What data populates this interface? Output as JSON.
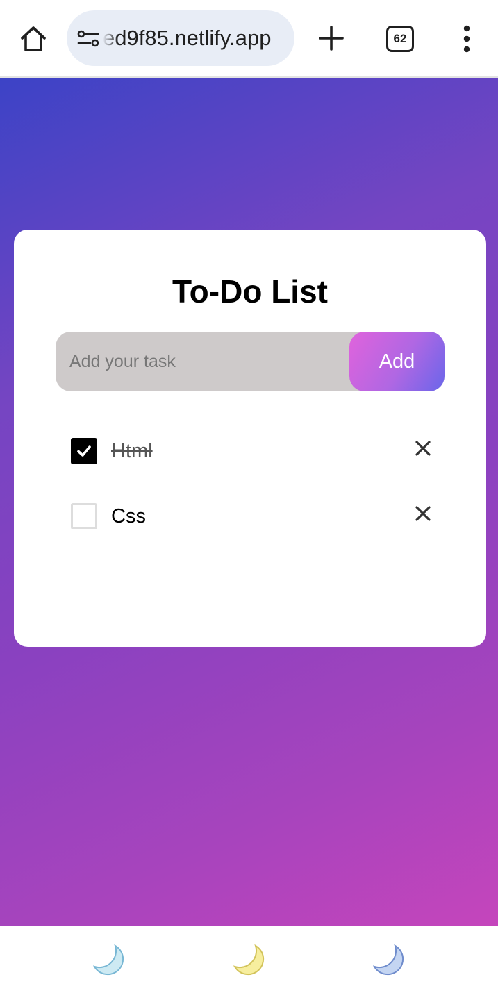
{
  "browser": {
    "url": "ed9f85.netlify.app",
    "tab_count": "62"
  },
  "todo": {
    "title": "To-Do List",
    "input_placeholder": "Add your task",
    "input_value": "",
    "add_label": "Add",
    "tasks": [
      {
        "text": "Html",
        "checked": true
      },
      {
        "text": "Css",
        "checked": false
      }
    ]
  },
  "bottom_bar": {
    "icons": [
      "moon-icon-blue",
      "moon-icon-yellow",
      "moon-icon-indigo"
    ]
  },
  "colors": {
    "gradient_start": "#3c43c6",
    "gradient_end": "#c545bc",
    "add_button_start": "#e063dc",
    "add_button_end": "#6a66ea",
    "input_background": "#cecaca"
  }
}
